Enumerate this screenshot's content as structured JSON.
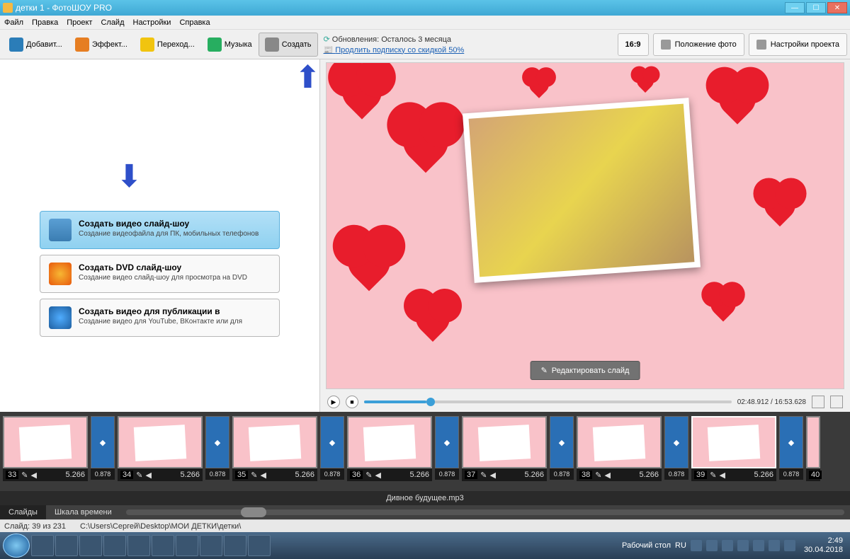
{
  "window": {
    "title": "детки 1 - ФотоШОУ PRO"
  },
  "menu": {
    "items": [
      "Файл",
      "Правка",
      "Проект",
      "Слайд",
      "Настройки",
      "Справка"
    ]
  },
  "toolbar": {
    "add": "Добавит...",
    "effects": "Эффект...",
    "transitions": "Переход...",
    "music": "Музыка",
    "create": "Создать"
  },
  "info": {
    "update": "Обновления: Осталось 3 месяца",
    "link": "Продлить подписку со скидкой 50%"
  },
  "right_tools": {
    "ratio": "16:9",
    "photo_pos": "Положение фото",
    "proj_settings": "Настройки проекта"
  },
  "options": [
    {
      "title": "Создать видео слайд-шоу",
      "desc": "Создание видеофайла для ПК, мобильных телефонов"
    },
    {
      "title": "Создать DVD слайд-шоу",
      "desc": "Создание видео слайд-шоу для просмотра на DVD"
    },
    {
      "title": "Создать видео для публикации в",
      "desc": "Создание видео для YouTube, ВКонтакте или для"
    }
  ],
  "preview": {
    "edit_btn": "Редактировать слайд",
    "time": "02:48.912 / 16:53.628"
  },
  "timeline": {
    "items": [
      {
        "n": "33",
        "dur": "5.266",
        "trans": "0.878"
      },
      {
        "n": "34",
        "dur": "5.266",
        "trans": "0.878"
      },
      {
        "n": "35",
        "dur": "5.266",
        "trans": "0.878"
      },
      {
        "n": "36",
        "dur": "5.266",
        "trans": "0.878"
      },
      {
        "n": "37",
        "dur": "5.266",
        "trans": "0.878"
      },
      {
        "n": "38",
        "dur": "5.266",
        "trans": "0.878"
      },
      {
        "n": "39",
        "dur": "5.266",
        "trans": "0.878"
      }
    ],
    "last_n": "40",
    "audio": "Дивное будущее.mp3",
    "tabs": {
      "slides": "Слайды",
      "timeline": "Шкала времени"
    }
  },
  "status": {
    "slide": "Слайд: 39 из 231",
    "path": "C:\\Users\\Сергей\\Desktop\\МОИ ДЕТКИ\\детки\\"
  },
  "tray": {
    "desktop": "Рабочий стол",
    "lang": "RU",
    "time": "2:49",
    "date": "30.04.2018"
  }
}
